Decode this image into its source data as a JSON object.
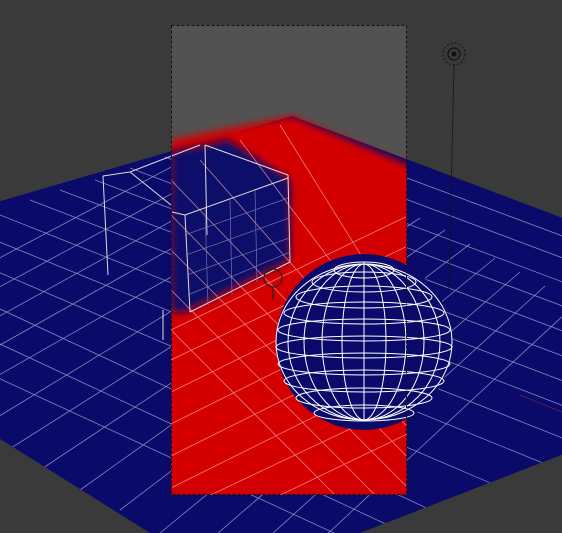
{
  "viewport": {
    "background_color": "#3a3a3a",
    "floor_color": "#0a0a6a",
    "render_region_fill": "#525252",
    "highlight_color": "#d40000",
    "wire_color": "#ffffff",
    "grid_line_color": "#c8c8c8"
  },
  "scene": {
    "objects": [
      "ground-plane",
      "box",
      "sphere",
      "light",
      "origin-marker",
      "render-region"
    ]
  },
  "icons": {
    "light": "lamp-target-icon",
    "origin": "object-origin-icon"
  }
}
